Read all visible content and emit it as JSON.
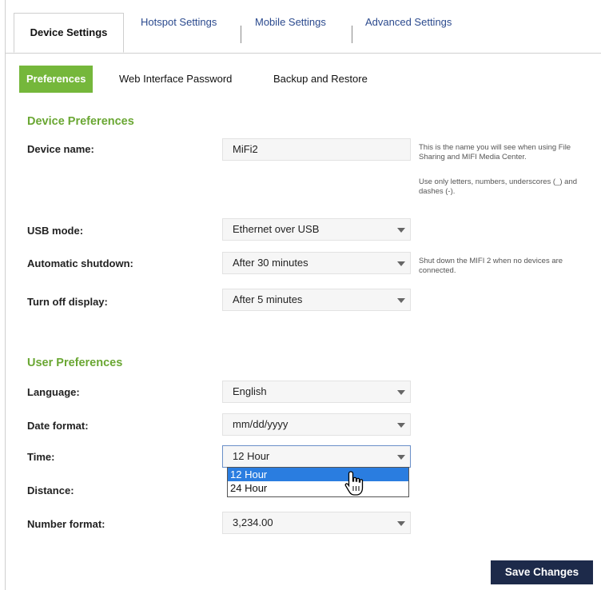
{
  "tabs": [
    {
      "label": "Device Settings"
    },
    {
      "label": "Hotspot Settings"
    },
    {
      "label": "Mobile Settings"
    },
    {
      "label": "Advanced Settings"
    }
  ],
  "subtabs": [
    {
      "label": "Preferences"
    },
    {
      "label": "Web Interface Password"
    },
    {
      "label": "Backup and Restore"
    }
  ],
  "device_prefs": {
    "title": "Device Preferences",
    "device_name": {
      "label": "Device name:",
      "value": "MiFi2"
    },
    "device_name_help_1": "This is the name you will see when using File Sharing and MIFI Media Center.",
    "device_name_help_2": "Use only letters, numbers, underscores (_) and dashes (-).",
    "usb_mode": {
      "label": "USB mode:",
      "value": "Ethernet over USB"
    },
    "auto_shutdown": {
      "label": "Automatic shutdown:",
      "value": "After 30 minutes"
    },
    "auto_shutdown_help": "Shut down the MIFI 2 when no devices are connected.",
    "display_off": {
      "label": "Turn off display:",
      "value": "After 5 minutes"
    }
  },
  "user_prefs": {
    "title": "User Preferences",
    "language": {
      "label": "Language:",
      "value": "English"
    },
    "date_format": {
      "label": "Date format:",
      "value": "mm/dd/yyyy"
    },
    "time": {
      "label": "Time:",
      "value": "12 Hour",
      "options": [
        "12 Hour",
        "24 Hour"
      ]
    },
    "distance": {
      "label": "Distance:"
    },
    "number_format": {
      "label": "Number format:",
      "value": "3,234.00"
    }
  },
  "save_label": "Save Changes",
  "colors": {
    "accent_green": "#75b73b",
    "button_navy": "#1d2a4a",
    "highlight_blue": "#2a7de0"
  }
}
